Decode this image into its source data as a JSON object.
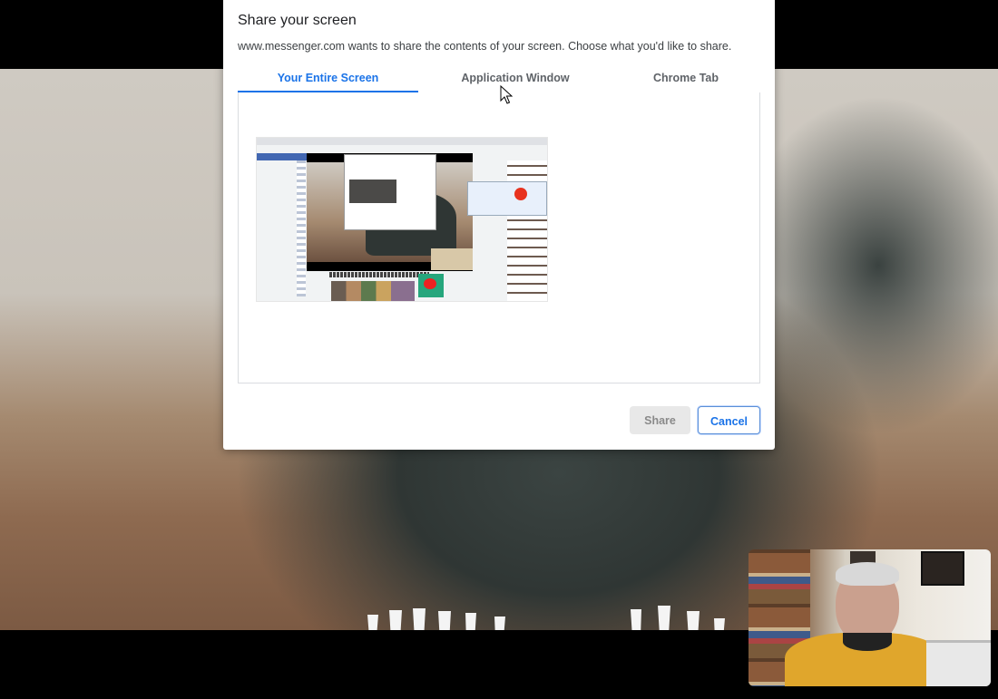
{
  "dialog": {
    "title": "Share your screen",
    "description": "www.messenger.com wants to share the contents of your screen. Choose what you'd like to share.",
    "tabs": [
      {
        "label": "Your Entire Screen",
        "active": true
      },
      {
        "label": "Application Window",
        "active": false
      },
      {
        "label": "Chrome Tab",
        "active": false
      }
    ],
    "buttons": {
      "share": "Share",
      "cancel": "Cancel"
    }
  },
  "colors": {
    "accent": "#1a73e8",
    "disabled_button_bg": "#e8e8e8",
    "disabled_button_text": "#8a8a8a"
  },
  "icons": {
    "cursor": "mouse-pointer-icon"
  }
}
